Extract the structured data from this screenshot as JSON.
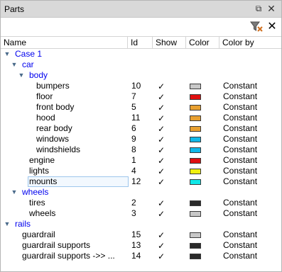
{
  "window": {
    "title": "Parts",
    "float_glyph": "⧉",
    "close_glyph": "✕"
  },
  "toolbar": {
    "filter_icon": "filter-icon",
    "clear_glyph": "✕"
  },
  "columns": {
    "name": "Name",
    "id": "Id",
    "show": "Show",
    "color": "Color",
    "color_by": "Color by"
  },
  "check_glyph": "✓",
  "tree": [
    {
      "name": "Case 1",
      "group": true,
      "expanded": true
    },
    {
      "name": "car",
      "group": true,
      "expanded": true
    },
    {
      "name": "body",
      "group": true,
      "expanded": true
    },
    {
      "name": "bumpers",
      "id": "10",
      "show": true,
      "color": "#c8c8c8",
      "color_by": "Constant"
    },
    {
      "name": "floor",
      "id": "7",
      "show": true,
      "color": "#e01010",
      "color_by": "Constant"
    },
    {
      "name": "front body",
      "id": "5",
      "show": true,
      "color": "#e8a030",
      "color_by": "Constant"
    },
    {
      "name": "hood",
      "id": "11",
      "show": true,
      "color": "#e8a030",
      "color_by": "Constant"
    },
    {
      "name": "rear body",
      "id": "6",
      "show": true,
      "color": "#e8a030",
      "color_by": "Constant"
    },
    {
      "name": "windows",
      "id": "9",
      "show": true,
      "color": "#10b8e8",
      "color_by": "Constant"
    },
    {
      "name": "windshields",
      "id": "8",
      "show": true,
      "color": "#10b8e8",
      "color_by": "Constant"
    },
    {
      "name": "engine",
      "id": "1",
      "show": true,
      "color": "#e01010",
      "color_by": "Constant"
    },
    {
      "name": "lights",
      "id": "4",
      "show": true,
      "color": "#f0f010",
      "color_by": "Constant"
    },
    {
      "name": "mounts",
      "id": "12",
      "show": true,
      "color": "#10e8e8",
      "color_by": "Constant",
      "selected": true
    },
    {
      "name": "wheels",
      "group": true,
      "expanded": true
    },
    {
      "name": "tires",
      "id": "2",
      "show": true,
      "color": "#2a2a2a",
      "color_by": "Constant"
    },
    {
      "name": "wheels",
      "id": "3",
      "show": true,
      "color": "#c8c8c8",
      "color_by": "Constant"
    },
    {
      "name": "rails",
      "group": true,
      "expanded": true
    },
    {
      "name": "guardrail",
      "id": "15",
      "show": true,
      "color": "#c8c8c8",
      "color_by": "Constant"
    },
    {
      "name": "guardrail supports",
      "id": "13",
      "show": true,
      "color": "#2a2a2a",
      "color_by": "Constant"
    },
    {
      "name": "guardrail supports ->> ...",
      "id": "14",
      "show": true,
      "color": "#2a2a2a",
      "color_by": "Constant"
    }
  ]
}
